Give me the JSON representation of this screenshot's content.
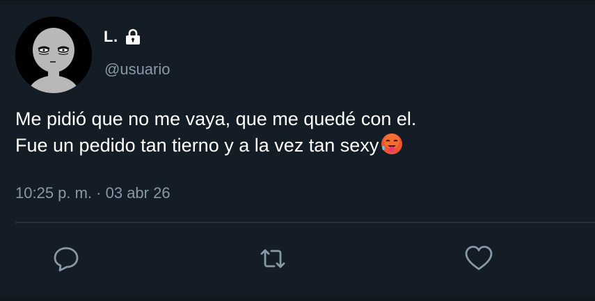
{
  "user": {
    "display_name": "L.",
    "handle": "@usuario",
    "protected_icon": "lock-icon",
    "avatar_icon": "sleepy-face-avatar"
  },
  "tweet": {
    "line1": "Me pidió que no me vaya, que me quedé con el.",
    "line2": "Fue un pedido tan tierno y a la vez tan sexy",
    "emoji": "hot-face-emoji",
    "timestamp": "10:25 p. m. · 03 abr 26"
  },
  "actions": [
    {
      "icon": "reply-icon"
    },
    {
      "icon": "retweet-icon"
    },
    {
      "icon": "like-icon"
    }
  ],
  "colors": {
    "background": "#141d26",
    "primary_text": "#ffffff",
    "secondary_text": "#8899a6",
    "divider": "#26313d"
  }
}
